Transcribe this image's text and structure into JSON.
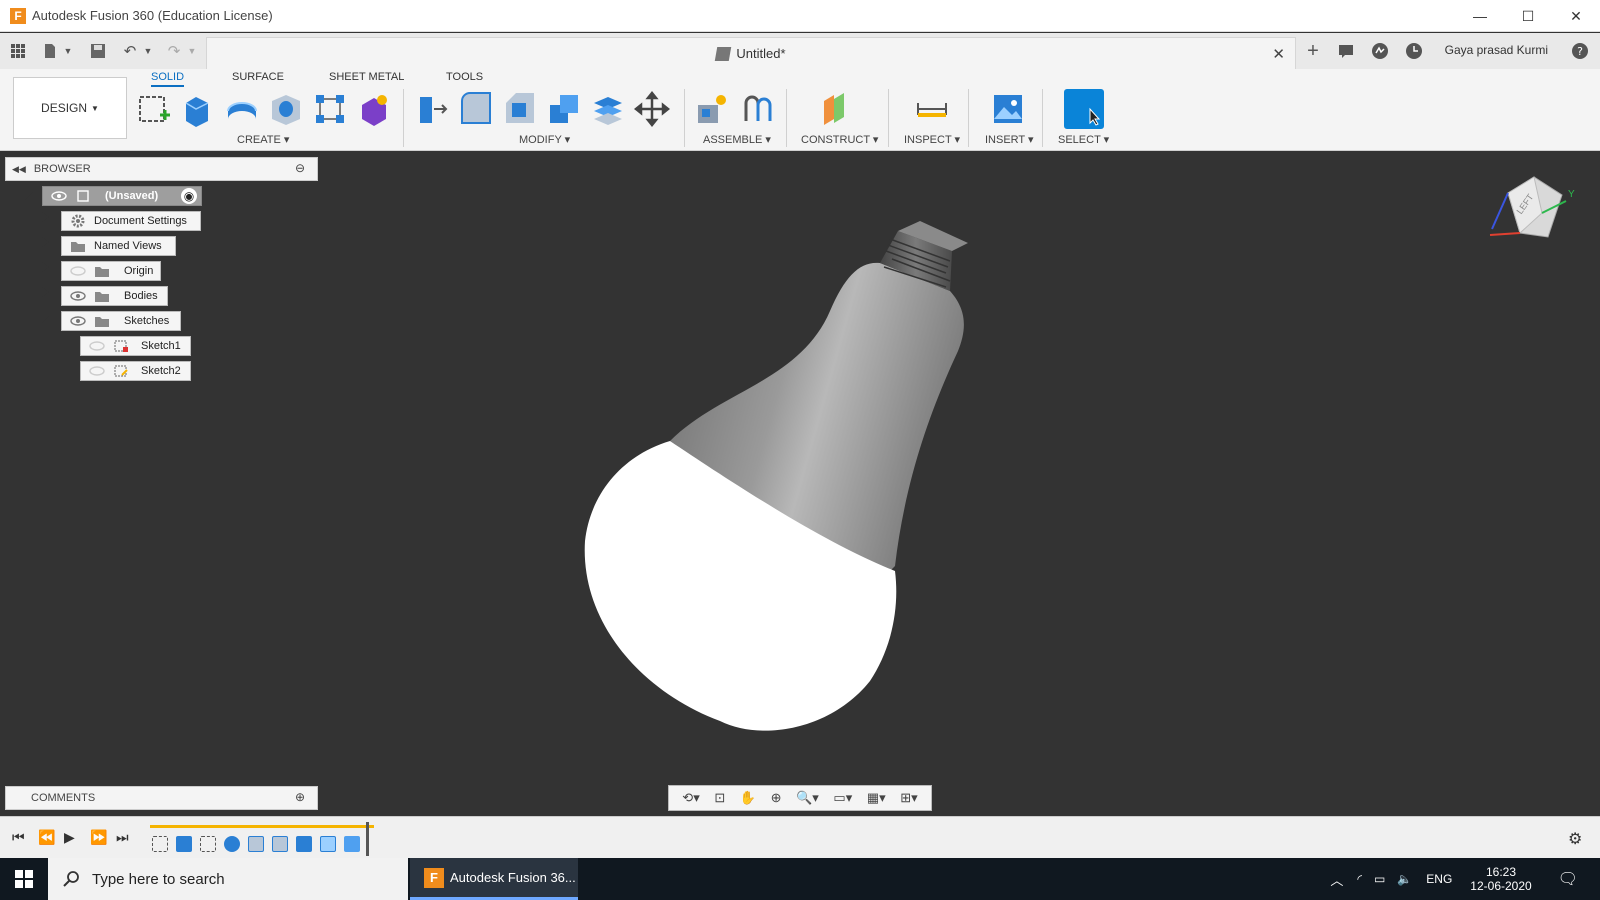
{
  "window": {
    "title": "Autodesk Fusion 360 (Education License)",
    "minimize": "—",
    "maximize": "☐",
    "close": "✕"
  },
  "quickbar": {
    "doc_tab": "Untitled*",
    "doc_close": "✕",
    "user": "Gaya prasad Kurmi"
  },
  "toolbar": {
    "workspace": "DESIGN",
    "tabs": [
      "SOLID",
      "SURFACE",
      "SHEET METAL",
      "TOOLS"
    ],
    "active_tab": "SOLID",
    "groups": [
      "CREATE",
      "MODIFY",
      "ASSEMBLE",
      "CONSTRUCT",
      "INSPECT",
      "INSERT",
      "SELECT"
    ]
  },
  "browser": {
    "title": "BROWSER",
    "items": [
      {
        "label": "(Unsaved)"
      },
      {
        "label": "Document Settings"
      },
      {
        "label": "Named Views"
      },
      {
        "label": "Origin"
      },
      {
        "label": "Bodies"
      },
      {
        "label": "Sketches"
      },
      {
        "label": "Sketch1"
      },
      {
        "label": "Sketch2"
      }
    ]
  },
  "viewcube": {
    "face": "LEFT",
    "axis_y": "Y"
  },
  "comments": {
    "title": "COMMENTS"
  },
  "taskbar": {
    "search_placeholder": "Type here to search",
    "app": "Autodesk Fusion 36...",
    "lang": "ENG",
    "time": "16:23",
    "date": "12-06-2020"
  },
  "colors": {
    "accent": "#0b6fc2",
    "viewport": "#333333",
    "timeline_bar": "#f5b400"
  }
}
